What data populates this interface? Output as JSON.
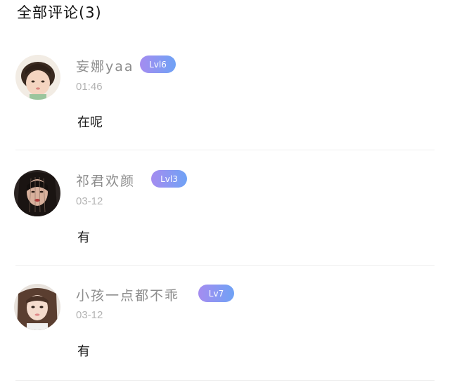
{
  "header": {
    "title": "全部评论(3)"
  },
  "comments": [
    {
      "name": "妄娜yaa",
      "level": "Lvl6",
      "time": "01:46",
      "text": "在呢"
    },
    {
      "name": "祁君欢颜",
      "level": "Lvl3",
      "time": "03-12",
      "text": "有"
    },
    {
      "name": "小孩一点都不乖",
      "level": "Lv7",
      "time": "03-12",
      "text": "有"
    }
  ],
  "colors": {
    "level_gradient_start": "#a58cf0",
    "level_gradient_end": "#6fa2f5",
    "name_gray": "#8c8c8c",
    "time_gray": "#b3b3b3"
  }
}
